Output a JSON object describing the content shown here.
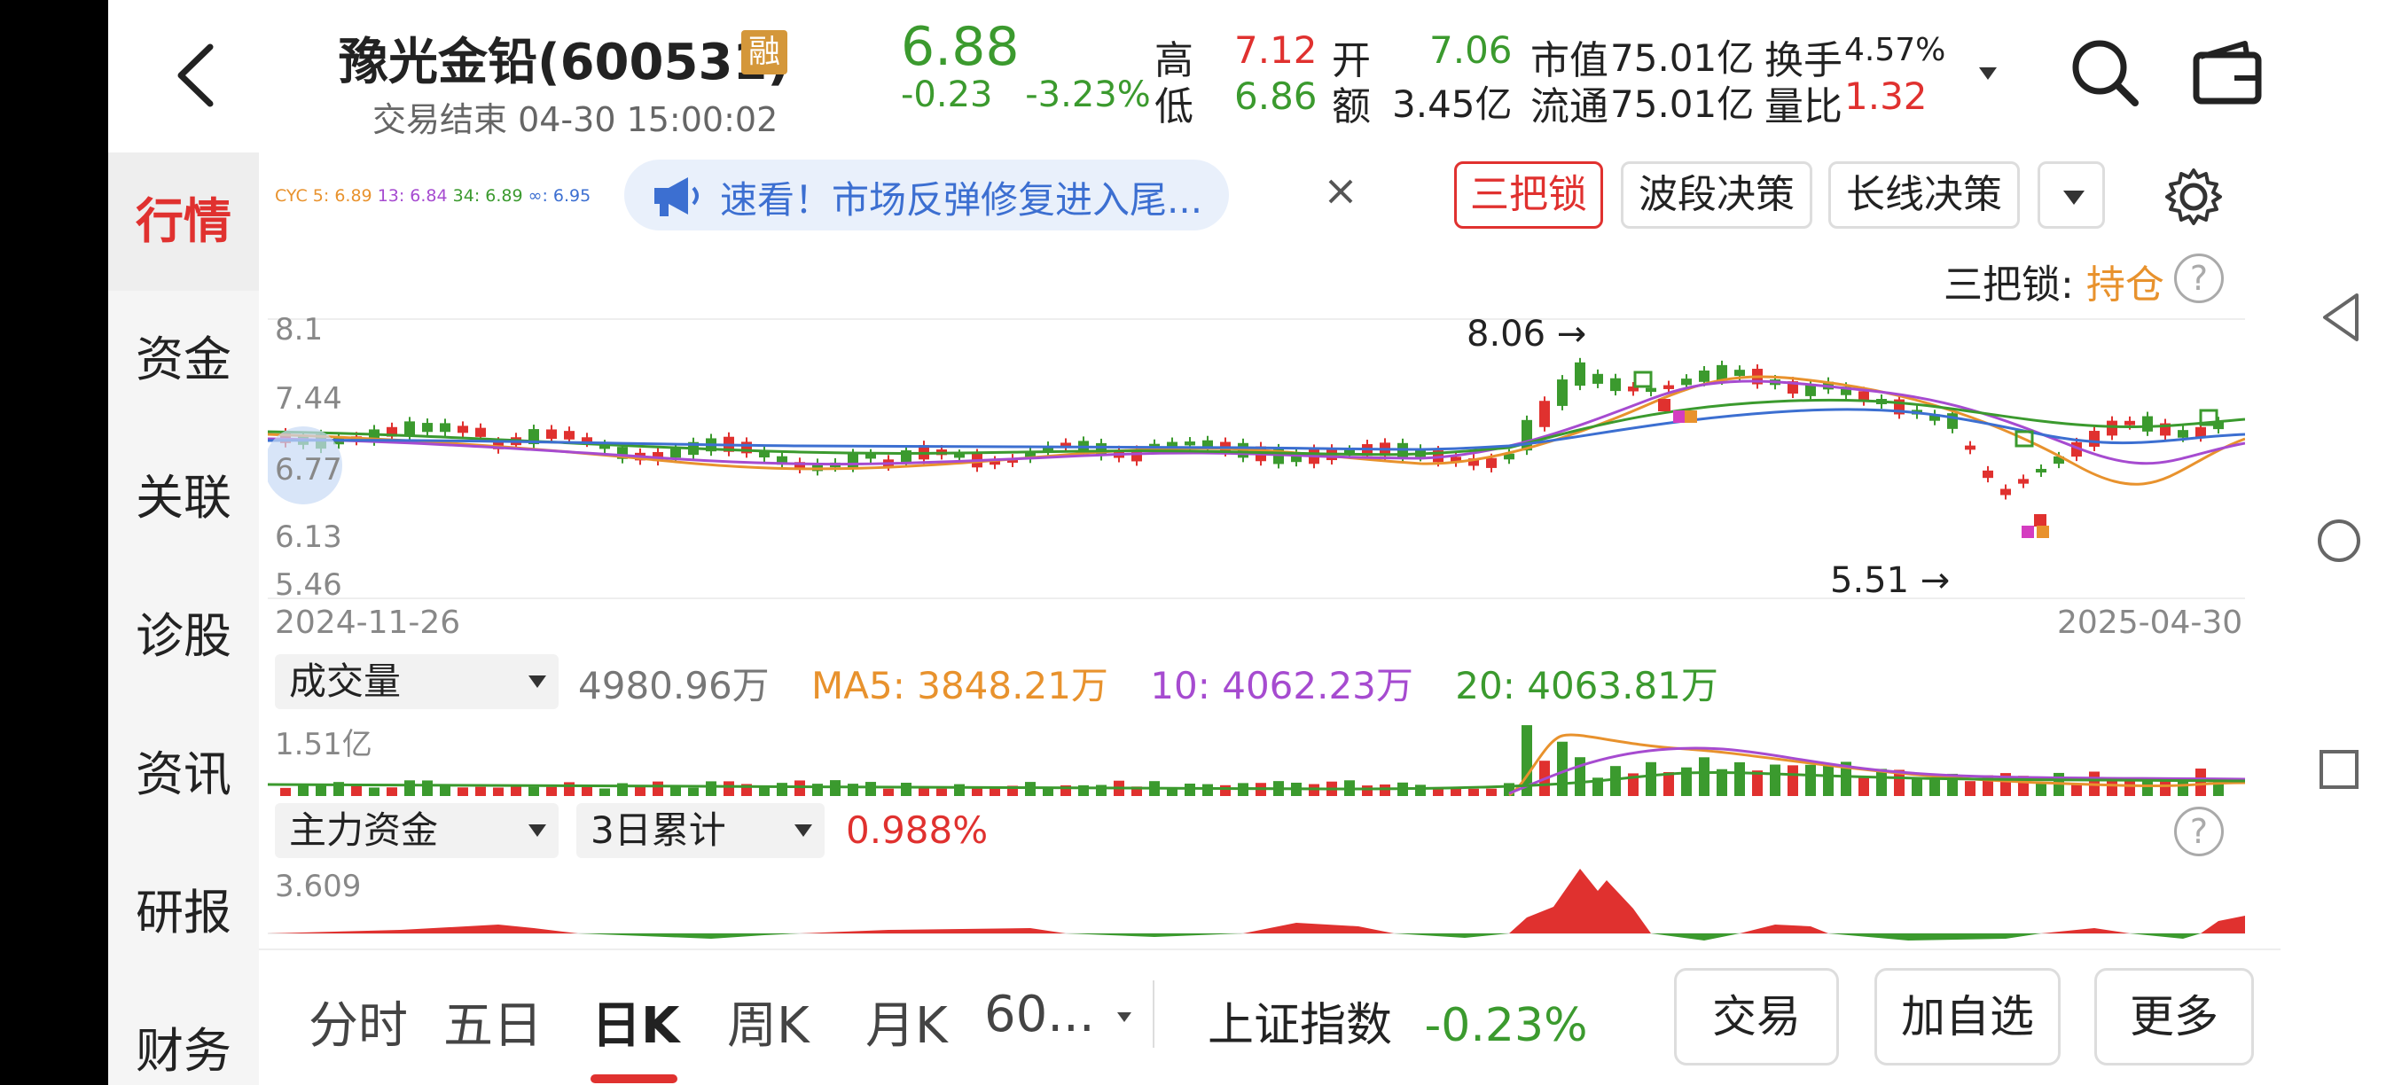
{
  "header": {
    "stock_name": "豫光金铅(600531)",
    "rong_badge": "融",
    "status": "交易结束 04-30 15:00:02",
    "price": "6.88",
    "change": "-0.23",
    "change_pct": "-3.23%",
    "high_label": "高",
    "high": "7.12",
    "low_label": "低",
    "low": "6.86",
    "open_label": "开",
    "open": "7.06",
    "amount_label": "额",
    "amount": "3.45亿",
    "mktcap_label": "市值",
    "mktcap": "75.01亿",
    "float_label": "流通",
    "float": "75.01亿",
    "turnover_label": "换手",
    "turnover": "4.57%",
    "volratio_label": "量比",
    "volratio": "1.32"
  },
  "sidebar": {
    "items": [
      {
        "label": "行情",
        "active": true
      },
      {
        "label": "资金"
      },
      {
        "label": "关联"
      },
      {
        "label": "诊股"
      },
      {
        "label": "资讯"
      },
      {
        "label": "研报"
      },
      {
        "label": "财务"
      }
    ]
  },
  "ma_legend": {
    "cyc5": "CYC 5: 6.89",
    "cyc13": "13: 6.84",
    "cyc34": "34: 6.89",
    "cycinf": "∞: 6.95"
  },
  "banner": {
    "text": "速看！市场反弹修复进入尾..."
  },
  "strategy_buttons": {
    "sanba": "三把锁",
    "boduan": "波段决策",
    "changxian": "长线决策"
  },
  "sanba_status": {
    "label": "三把锁:",
    "value": "持仓"
  },
  "kline": {
    "y_labels": [
      "8.1",
      "7.44",
      "6.77",
      "6.13",
      "5.46"
    ],
    "max_label": "8.06",
    "min_label": "5.51",
    "start_date": "2024-11-26",
    "end_date": "2025-04-30"
  },
  "volume": {
    "selector": "成交量",
    "value": "4980.96万",
    "ma5": "MA5: 3848.21万",
    "ma10": "10: 4062.23万",
    "ma20": "20: 4063.81万",
    "max": "1.51亿"
  },
  "flow": {
    "selector": "主力资金",
    "period": "3日累计",
    "value": "0.988%",
    "max": "3.609"
  },
  "tabs": {
    "items": [
      "分时",
      "五日",
      "日K",
      "周K",
      "月K",
      "60..."
    ],
    "active": "日K"
  },
  "index": {
    "name": "上证指数",
    "change": "-0.23%"
  },
  "actions": {
    "trade": "交易",
    "add_watch": "加自选",
    "more": "更多"
  },
  "colors": {
    "up": "#e0312f",
    "down": "#3b9a2e",
    "accent_blue": "#3c6fd1",
    "hold": "#e8922d"
  }
}
